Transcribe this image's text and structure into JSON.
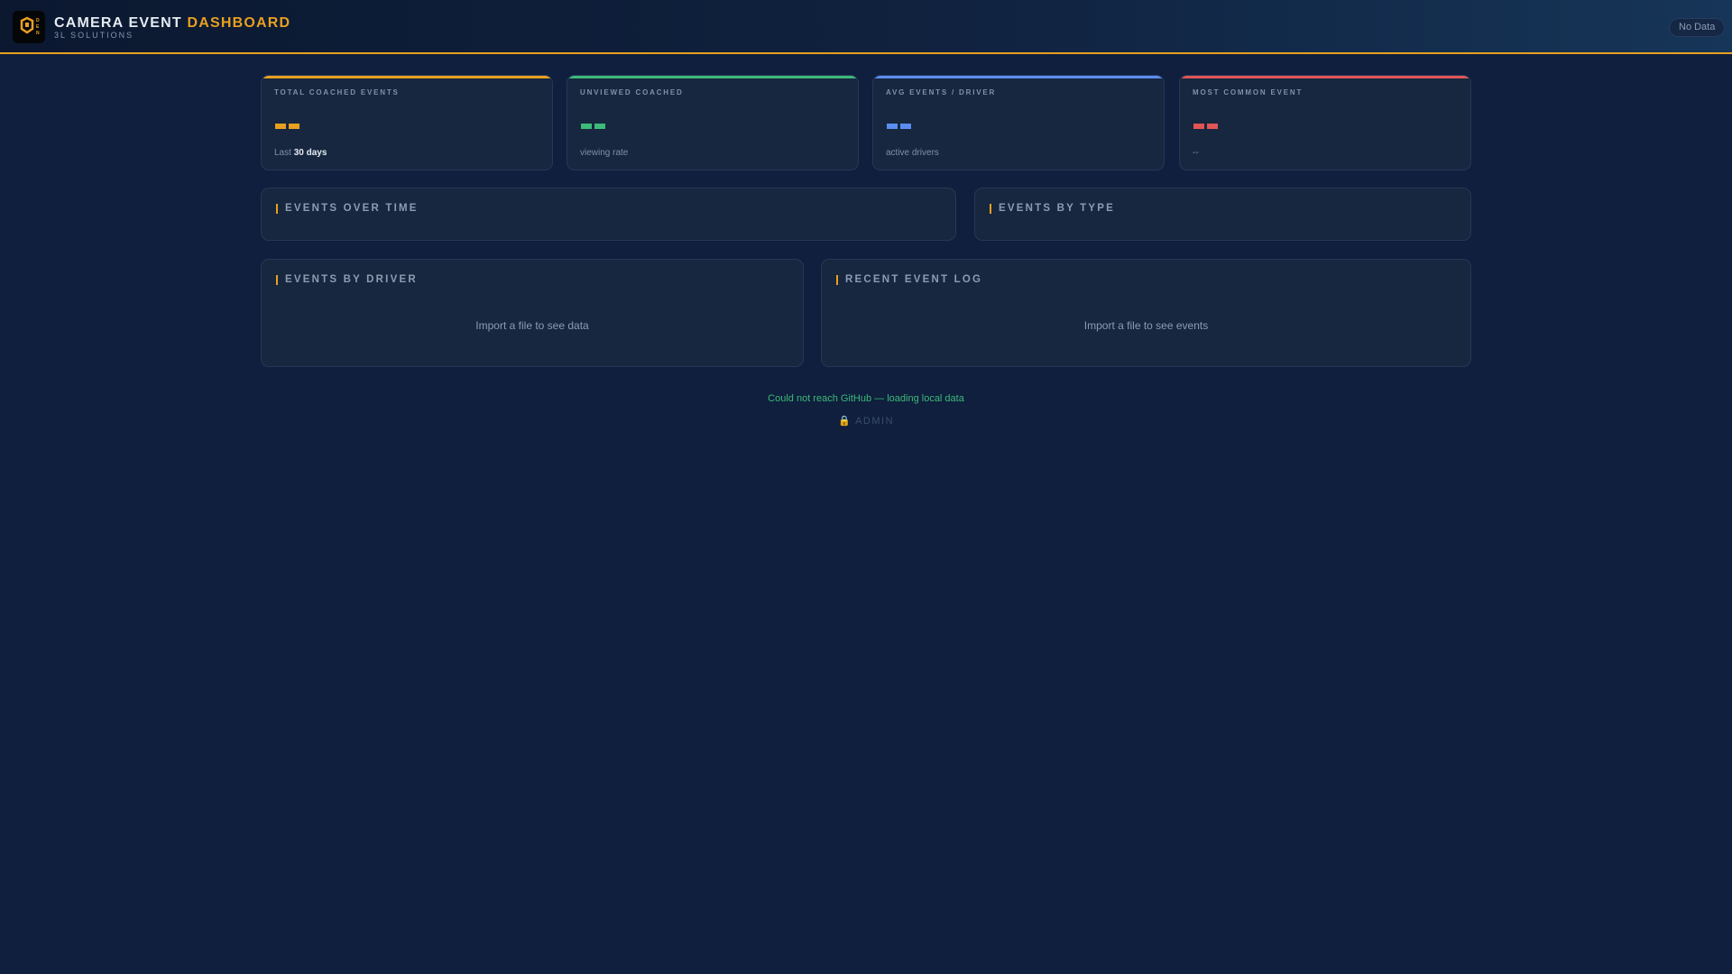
{
  "header": {
    "title_main": "CAMERA EVENT",
    "title_accent": "DASHBOARD",
    "subtitle": "3L SOLUTIONS",
    "logo_text": "DEN",
    "status_badge": "No Data"
  },
  "colors": {
    "accent": "#e8a020",
    "green": "#3dba78",
    "blue": "#5b8def",
    "red": "#e05555"
  },
  "cards": [
    {
      "label": "TOTAL COACHED EVENTS",
      "value": "--",
      "sub_prefix": "Last",
      "sub_bold": "30 days",
      "color": "#e8a020"
    },
    {
      "label": "UNVIEWED COACHED",
      "value": "--",
      "sub_prefix": "viewing rate",
      "sub_bold": "",
      "color": "#3dba78"
    },
    {
      "label": "AVG EVENTS / DRIVER",
      "value": "--",
      "sub_prefix": "active drivers",
      "sub_bold": "",
      "color": "#5b8def"
    },
    {
      "label": "MOST COMMON EVENT",
      "value": "--",
      "sub_prefix": "--",
      "sub_bold": "",
      "color": "#e05555"
    }
  ],
  "panels": {
    "events_over_time": "EVENTS OVER TIME",
    "events_by_type": "EVENTS BY TYPE",
    "events_by_driver": "EVENTS BY DRIVER",
    "events_by_driver_empty": "Import a file to see data",
    "recent_event_log": "RECENT EVENT LOG",
    "recent_event_log_empty": "Import a file to see events"
  },
  "footer": {
    "status": "Could not reach GitHub — loading local data",
    "admin": "ADMIN",
    "admin_icon": "lock-icon"
  }
}
